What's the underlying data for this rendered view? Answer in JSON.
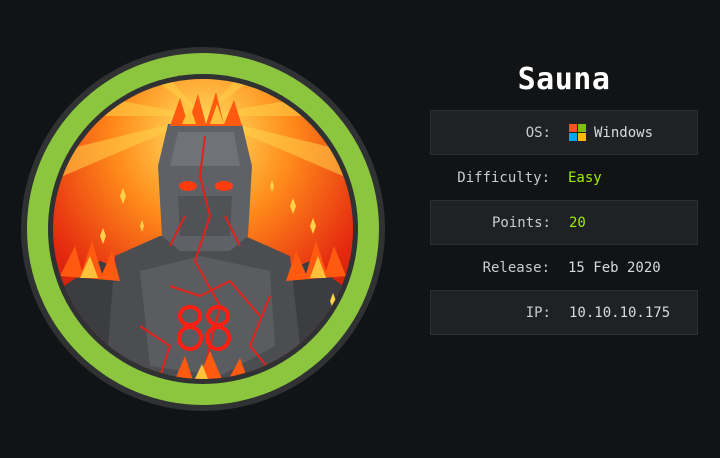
{
  "machine": {
    "name": "Sauna",
    "avatar_icon": "stone-golem-avatar-icon",
    "ring_color": "#8cc63f",
    "background": "#111315"
  },
  "details": {
    "os": {
      "label": "OS:",
      "value": "Windows",
      "icon": "windows-logo-icon"
    },
    "difficulty": {
      "label": "Difficulty:",
      "value": "Easy",
      "color": "#9fef00"
    },
    "points": {
      "label": "Points:",
      "value": "20",
      "color": "#9fef00"
    },
    "release": {
      "label": "Release:",
      "value": "15 Feb 2020"
    },
    "ip": {
      "label": "IP:",
      "value": "10.10.10.175"
    }
  }
}
